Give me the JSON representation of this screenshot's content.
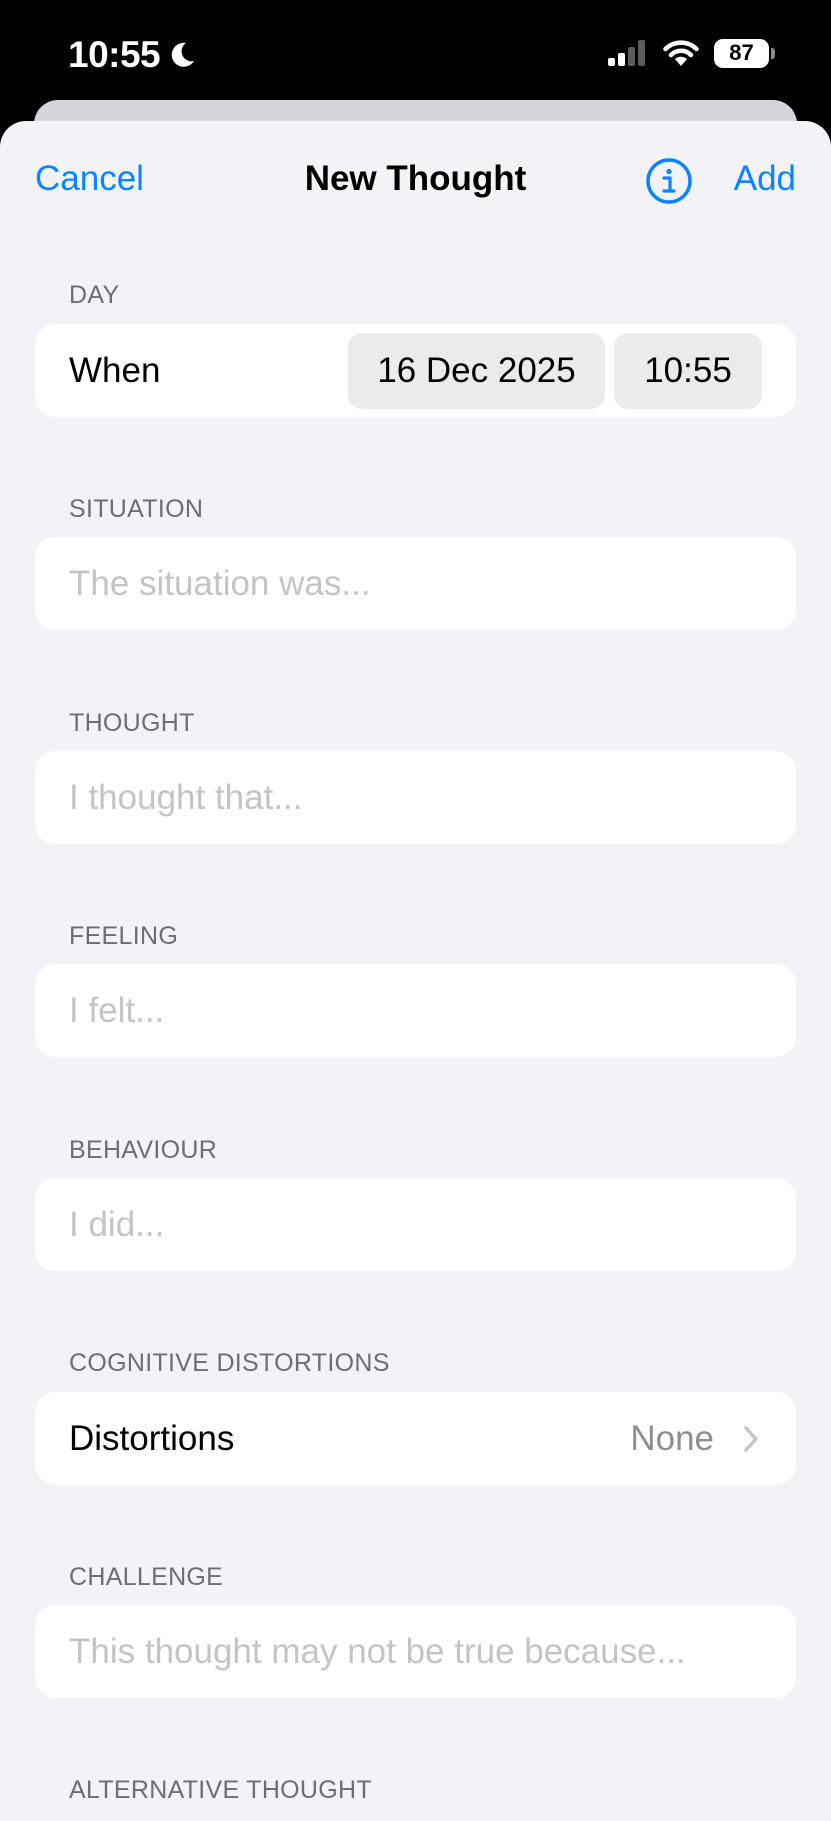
{
  "status_bar": {
    "time": "10:55",
    "battery": "87"
  },
  "nav": {
    "cancel_label": "Cancel",
    "title": "New Thought",
    "add_label": "Add"
  },
  "sections": {
    "day": {
      "header": "DAY",
      "row_label": "When",
      "date": "16 Dec 2025",
      "time": "10:55"
    },
    "situation": {
      "header": "SITUATION",
      "placeholder": "The situation was..."
    },
    "thought": {
      "header": "THOUGHT",
      "placeholder": "I thought that..."
    },
    "feeling": {
      "header": "FEELING",
      "placeholder": "I felt..."
    },
    "behaviour": {
      "header": "BEHAVIOUR",
      "placeholder": "I did..."
    },
    "distortions": {
      "header": "COGNITIVE DISTORTIONS",
      "row_label": "Distortions",
      "value": "None"
    },
    "challenge": {
      "header": "CHALLENGE",
      "placeholder": "This thought may not be true because..."
    },
    "alternative": {
      "header": "ALTERNATIVE THOUGHT"
    }
  },
  "colors": {
    "accent": "#0a84ff",
    "background": "#f2f2f7",
    "card": "#ffffff",
    "secondary_text": "#6d6d72",
    "placeholder": "#c4c4c7"
  },
  "icons": [
    "moon-icon",
    "signal-icon",
    "wifi-icon",
    "battery-icon",
    "info-icon",
    "chevron-right-icon"
  ]
}
